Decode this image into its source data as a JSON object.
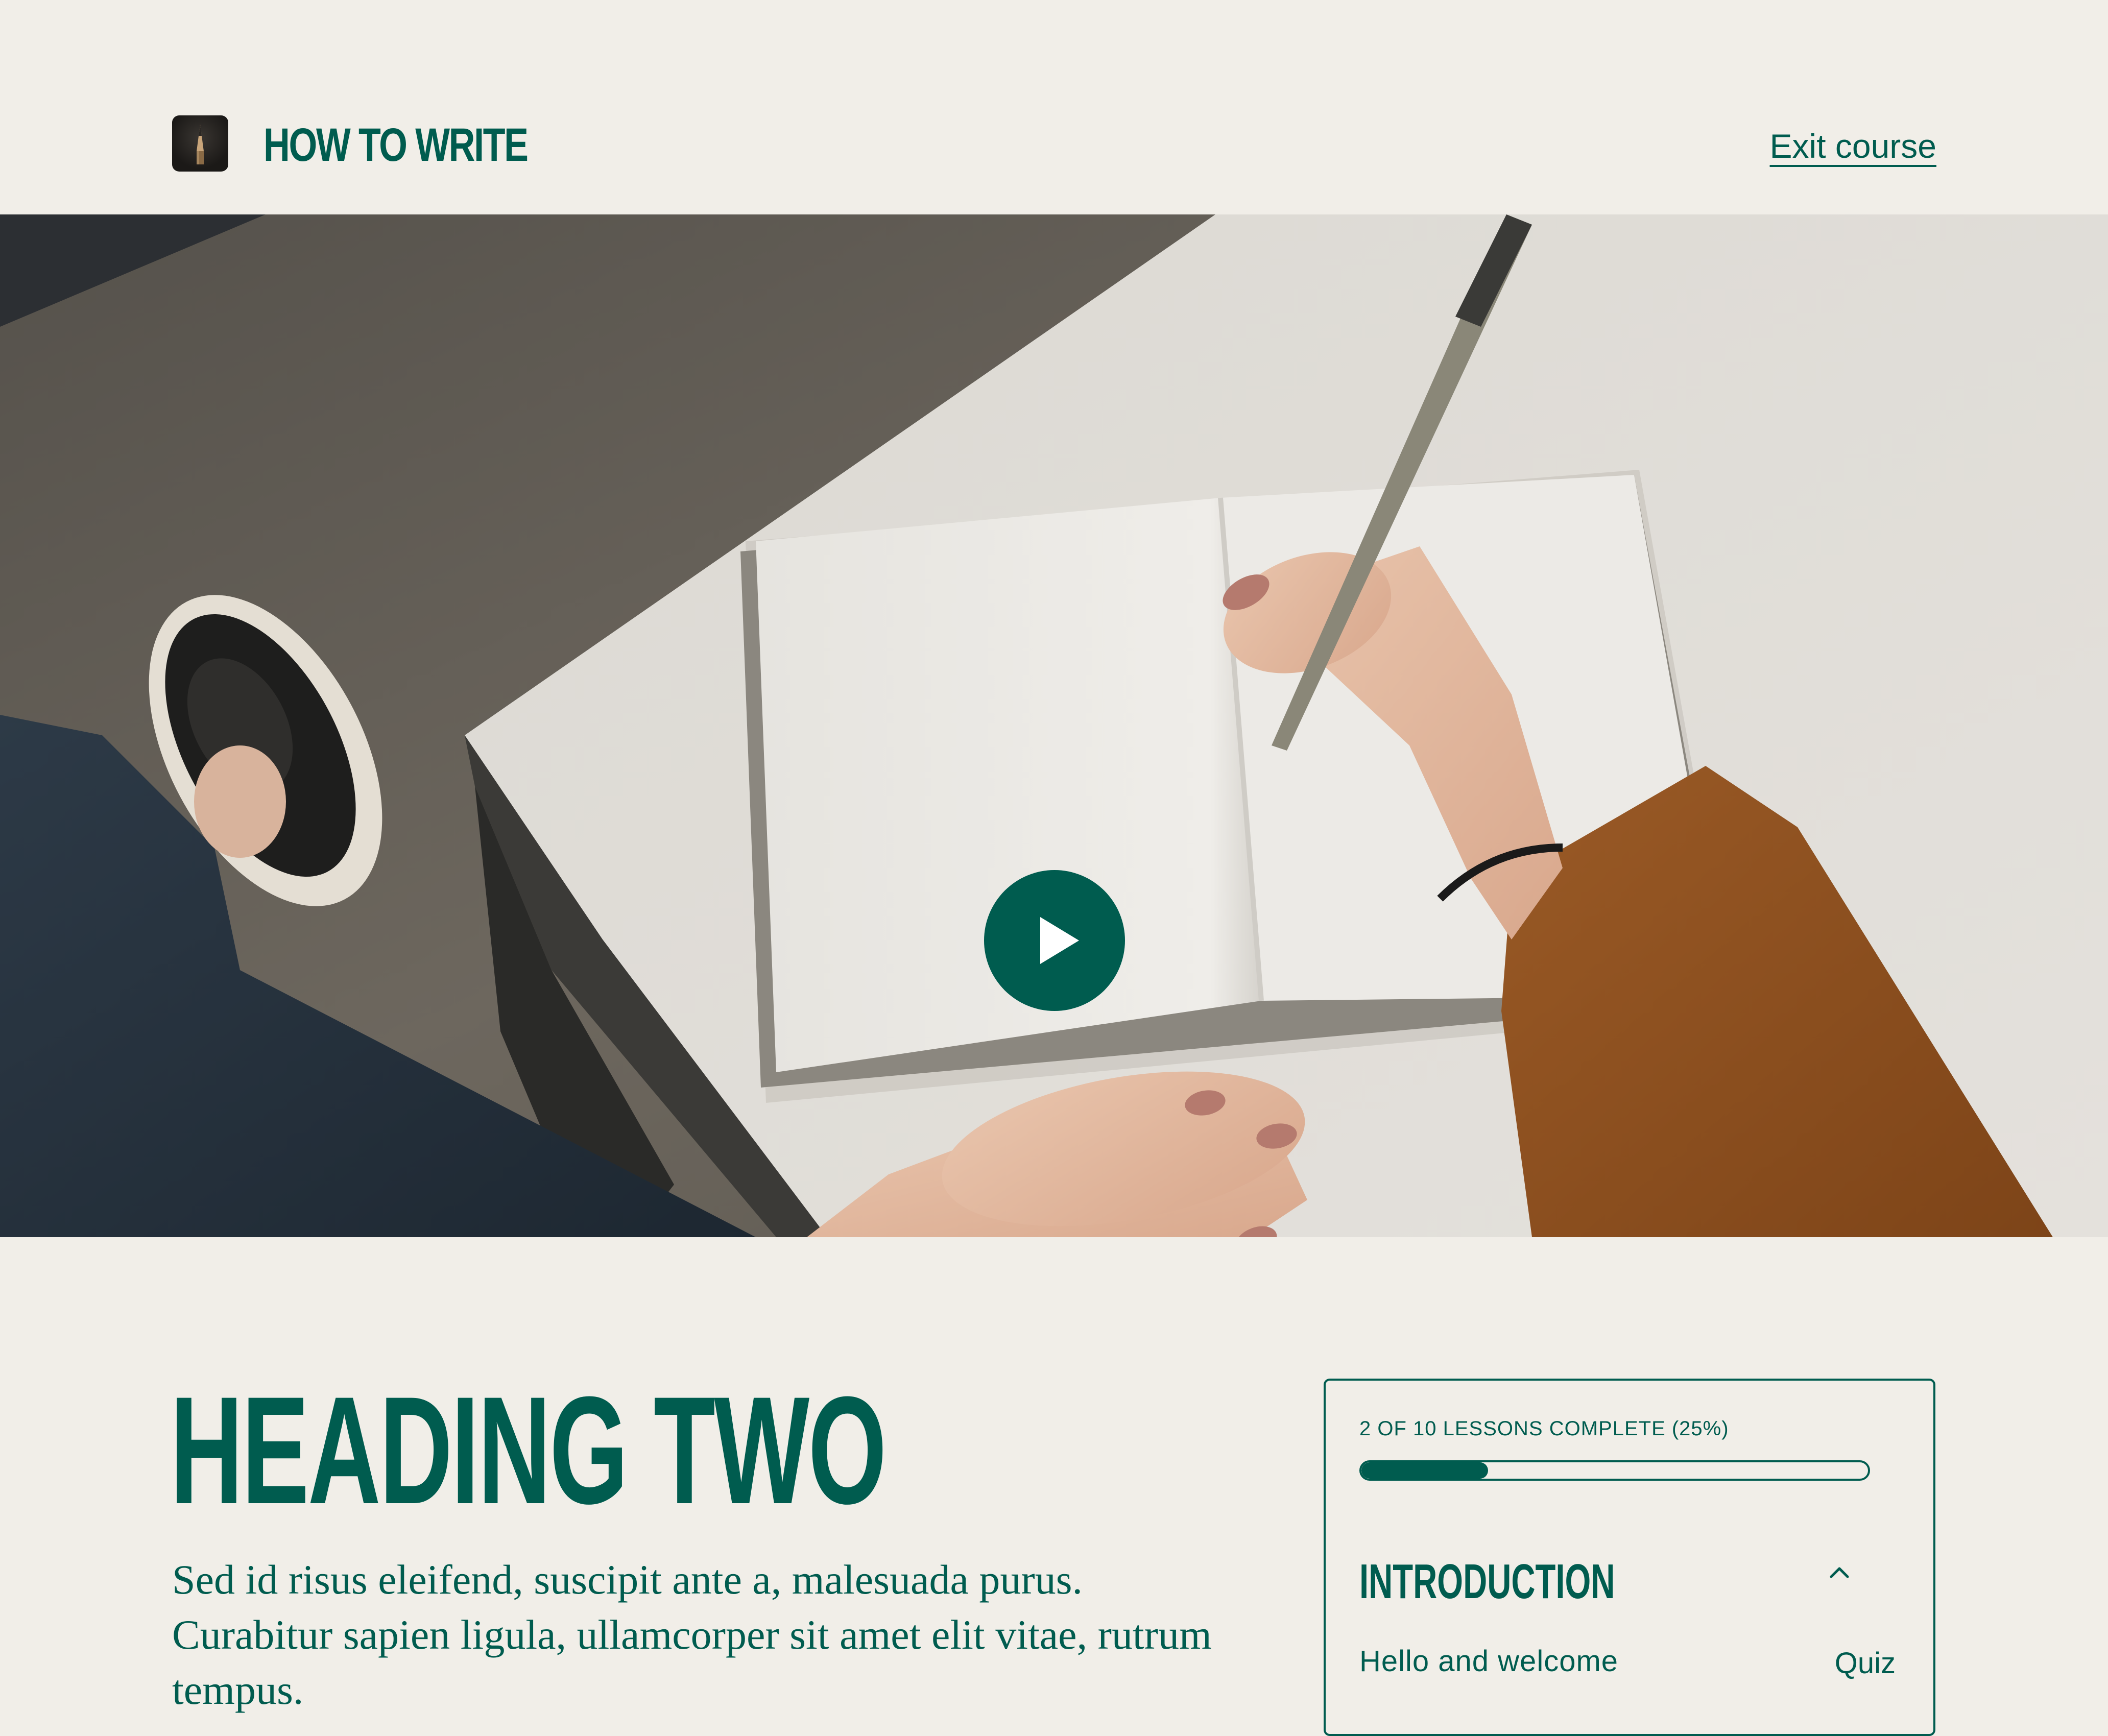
{
  "header": {
    "course_title": "HOW TO WRITE",
    "exit_label": "Exit course"
  },
  "hero": {
    "play_label": "Play video"
  },
  "main": {
    "heading": "HEADING TWO",
    "body": "Sed id risus eleifend, suscipit ante a, malesuada purus. Curabitur sapien ligula, ullamcorper sit amet elit vitae, rutrum tempus."
  },
  "progress": {
    "label": "2 OF 10 LESSONS COMPLETE (25%)",
    "completed": 2,
    "total": 10,
    "percent": 25
  },
  "sections": [
    {
      "title": "INTRODUCTION",
      "expanded": true,
      "lessons": [
        {
          "title": "Hello and welcome",
          "type": "Quiz"
        }
      ]
    }
  ],
  "colors": {
    "accent": "#005c4f",
    "background": "#f1eee8"
  },
  "icons": {
    "logo": "pencil-logo-icon",
    "play": "play-icon",
    "collapse": "chevron-up-icon"
  }
}
